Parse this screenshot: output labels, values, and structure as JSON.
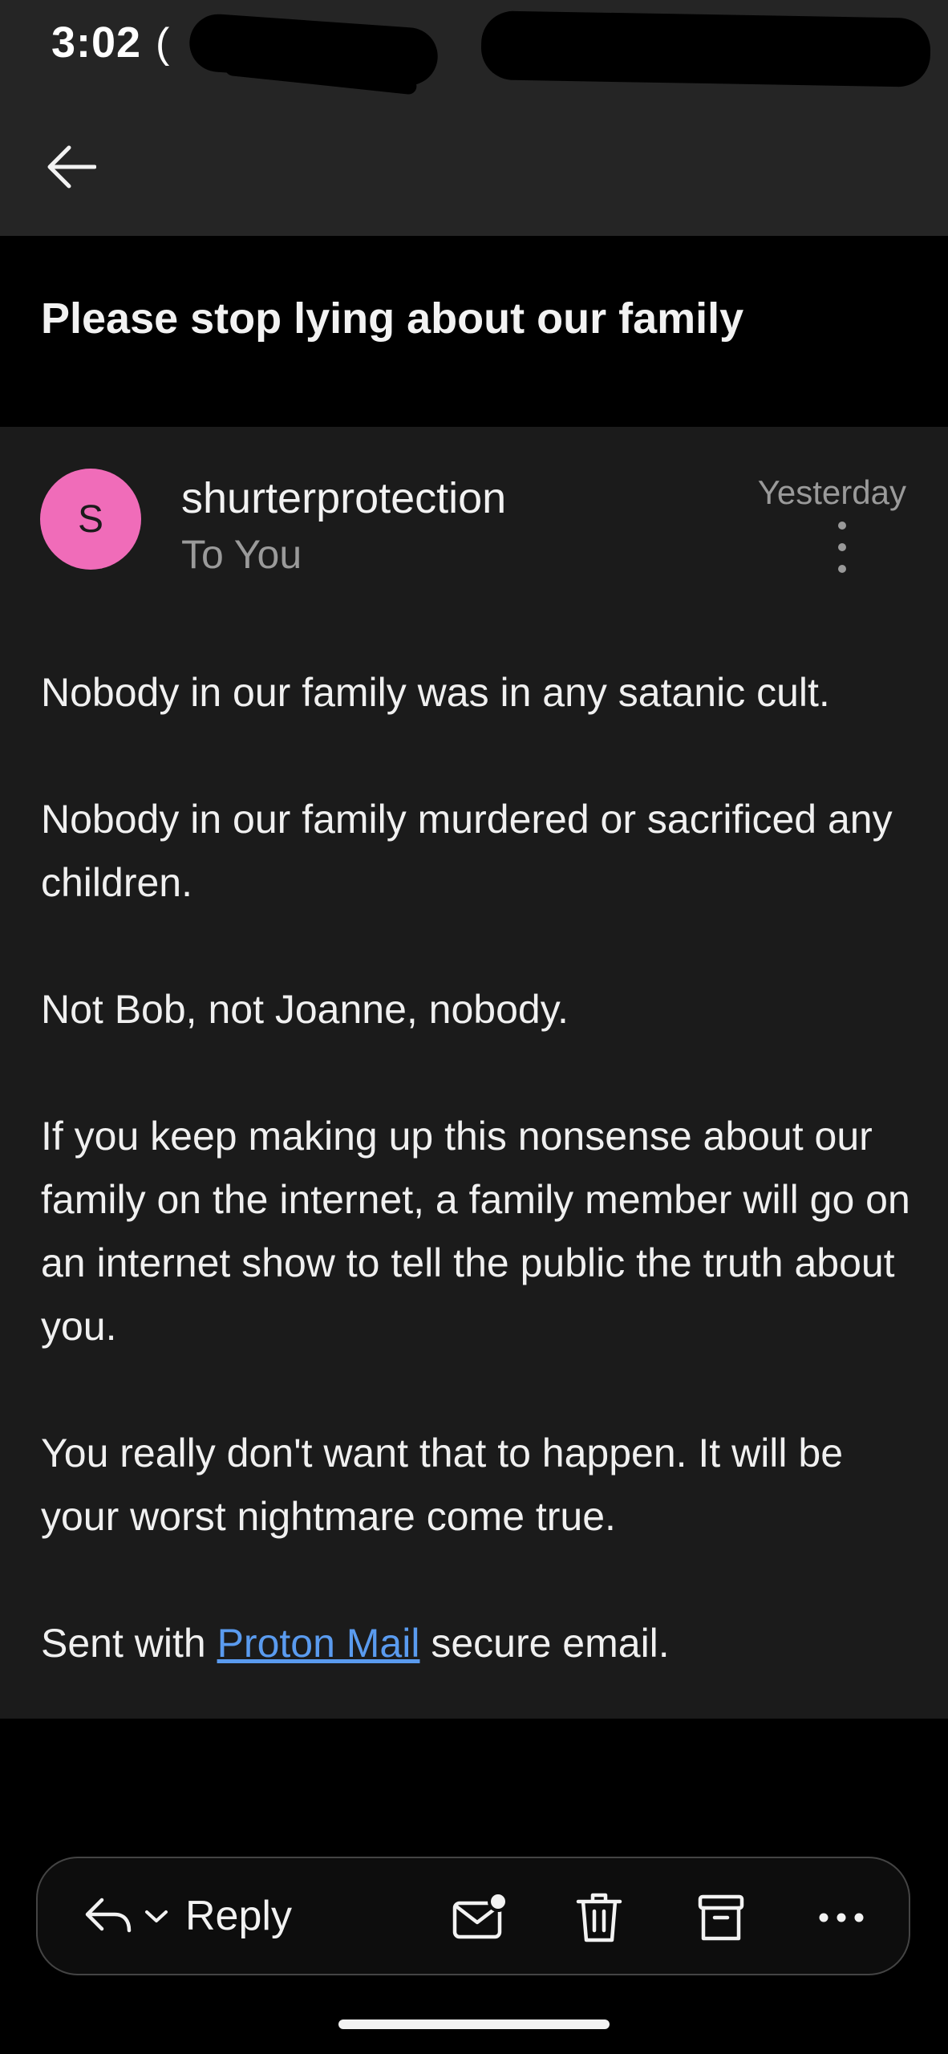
{
  "status_bar": {
    "time": "3:02",
    "extra": "("
  },
  "header": {
    "back_icon": "arrow-left-icon"
  },
  "email": {
    "subject": "Please stop lying about our family",
    "sender_initial": "S",
    "sender": "shurterprotection",
    "recipient": "To You",
    "date": "Yesterday",
    "avatar_color": "#f06cb9",
    "body": [
      "Nobody in our family was in any satanic cult.",
      "Nobody in our family murdered or sacrificed any children.",
      "Not Bob, not Joanne, nobody.",
      "If you keep making up this nonsense about our family on the internet, a family member will go on an internet show to tell the public the truth about you.",
      "You really don't want that to happen.  It will be your worst nightmare come true."
    ],
    "signature": {
      "prefix": "Sent with ",
      "link": "Proton Mail",
      "suffix": " secure email."
    },
    "link_color": "#5a9bef"
  },
  "actions": {
    "reply_label": "Reply",
    "icons": [
      "reply-icon",
      "chevron-down-icon",
      "mark-unread-icon",
      "trash-icon",
      "archive-icon",
      "more-horizontal-icon"
    ]
  }
}
